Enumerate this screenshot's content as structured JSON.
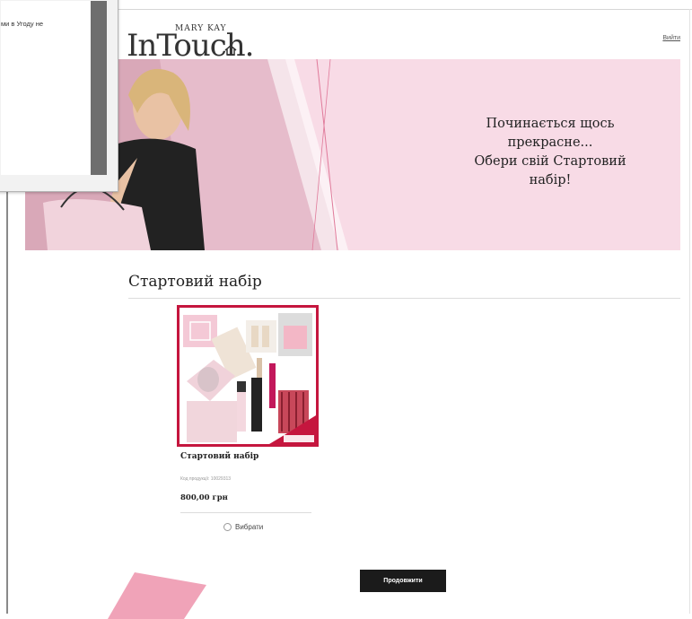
{
  "header": {
    "brand_small": "MARY KAY",
    "brand_main": "InTouch.",
    "login_label": "Вийти"
  },
  "hero": {
    "text_lines": [
      "Починається щось",
      "прекрасне...",
      "Обери свій Стартовий",
      "набір!"
    ]
  },
  "section": {
    "title": "Стартовий набір"
  },
  "product": {
    "name": "Стартовий набір",
    "code_label": "Код продукції: 10029313",
    "price": "800,00 грн",
    "select_label": "Вибрати"
  },
  "actions": {
    "continue_label": "Продовжити"
  },
  "popup": {
    "text": "ми в Угоду не"
  },
  "colors": {
    "accent": "#c5163e",
    "hero_bg": "#f8dbe6",
    "button_bg": "#1b1b1b",
    "arrow": "#f0a3b8"
  }
}
